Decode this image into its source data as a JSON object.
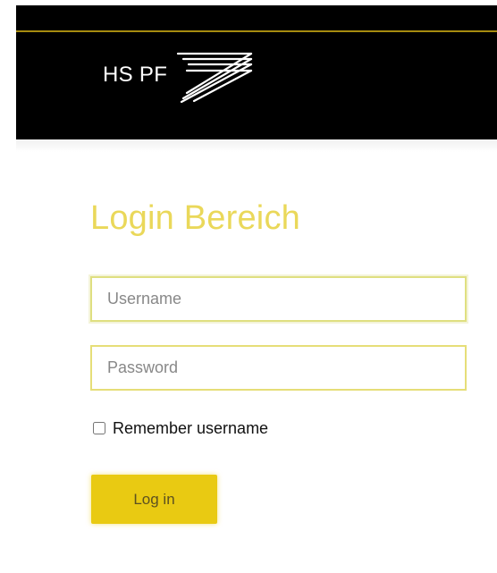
{
  "header": {
    "brand_text": "HS PF",
    "logo_icon": "hs-pf-logo-icon",
    "background_color": "#000000",
    "accent_color": "#b89a12"
  },
  "login": {
    "title": "Login Bereich",
    "username_placeholder": "Username",
    "password_placeholder": "Password",
    "remember_label": "Remember username",
    "button_label": "Log in",
    "title_color": "#ead85a",
    "button_color": "#e9ca12"
  }
}
